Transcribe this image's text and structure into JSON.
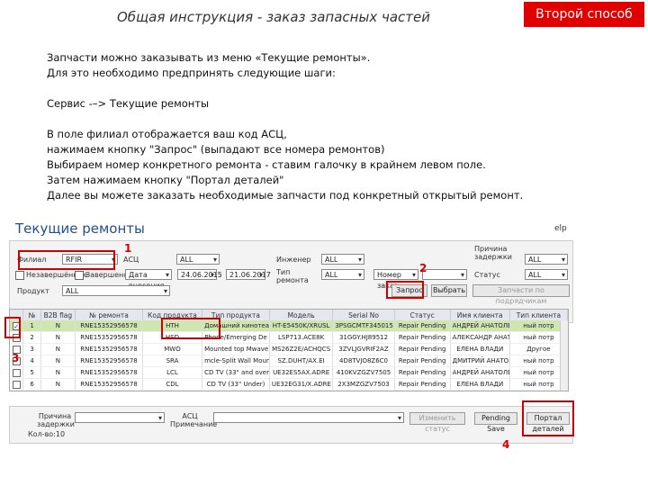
{
  "header": {
    "title": "Общая инструкция - заказ запасных частей",
    "badge": "Второй способ"
  },
  "instructions": [
    "Запчасти можно заказывать из меню «Текущие ремонты».",
    "Для это необходимо предпринять следующие шаги:",
    "Сервис -–> Текущие ремонты",
    "В поле филиал отображается ваш код АСЦ,",
    "нажимаем кнопку \"Запрос\" (выпадают все номера ремонтов)",
    "Выбираем номер конкретного ремонта - ставим галочку в крайнем левом поле.",
    "Затем нажимаем кнопку \"Портал деталей\"",
    "Далее вы можете заказать необходимые запчасти под конкретный открытый ремонт."
  ],
  "app": {
    "title": "Текущие ремонты",
    "help": "elp",
    "filters": {
      "branch_label": "Филиал",
      "branch_value": "RFIR",
      "asc_label": "АСЦ",
      "asc_value": "ALL",
      "engineer_label": "Инженер",
      "engineer_value": "ALL",
      "delay_reason_label": "Причина задержки",
      "delay_reason_value": "ALL",
      "unfinished_label": "Незавершённые",
      "finished_label": "Завершено",
      "date_select": "Дата внесения",
      "date_from": "24.06.2015",
      "date_to": "21.06.2017",
      "repair_type_label": "Тип ремонта",
      "repair_type_value": "ALL",
      "number_select": "Номер заказ",
      "search_value": "",
      "status_label": "Статус",
      "status_value": "ALL",
      "product_label": "Продукт",
      "product_value": "ALL",
      "query_button": "Запрос",
      "select_button": "Выбрать",
      "other_button": "Запчасти по подрядчикам"
    },
    "grid": {
      "columns": [
        "",
        "№",
        "B2B flag",
        "№ ремонта",
        "Код продукта",
        "Тип продукта",
        "Модель",
        "Serial No",
        "Статус",
        "Имя клиента",
        "Тип клиента"
      ],
      "rows": [
        [
          "",
          "1",
          "N",
          "RNE15352956578",
          "HTH",
          "Домашний кинотеатр",
          "HT-E5450K/XRUSL",
          "3PSGCMTF345015",
          "Repair Pending",
          "АНДРЕЙ АНАТОЛЕ",
          "ный потр"
        ],
        [
          "",
          "2",
          "N",
          "RNE15352956578",
          "HSD",
          "Phone/Emerging De",
          "LSP713.ACE8K",
          "31GGY.HJ89512",
          "Repair Pending",
          "АЛЕКСАНДР АНАТОЛЕ",
          "ный потр"
        ],
        [
          "",
          "3",
          "N",
          "RNE15352956578",
          "MWO",
          "Mounted top Mwave",
          "MS26Z2E/ACHQCS",
          "3ZVLJGVRIF2AZ",
          "Repair Pending",
          "ЕЛЕНА ВЛАДИ",
          "Другое"
        ],
        [
          "",
          "4",
          "N",
          "RNE15352956578",
          "SRA",
          "mcle-Split Wall Mounte",
          "SZ.DUHT/AX.EI",
          "4D8TVJO8Z6C0",
          "Repair Pending",
          "ДМИТРИЙ АНАТОЛ",
          "ный потр"
        ],
        [
          "",
          "5",
          "N",
          "RNE15352956578",
          "LCL",
          "CD TV (33\" and over",
          "UE32ES5AX.ADRE",
          "410KVZGZV7505",
          "Repair Pending",
          "АНДРЕЙ АНАТОЛЕ",
          "ный потр"
        ],
        [
          "",
          "6",
          "N",
          "RNE15352956578",
          "CDL",
          "CD TV (33\" Under)",
          "UE32EG31/X.ADRE",
          "2X3MZGZV7503",
          "Repair Pending",
          "ЕЛЕНА ВЛАДИ",
          "ный потр"
        ]
      ]
    },
    "bottom": {
      "reason_label": "Причина задержки",
      "asc_comment_label": "АСЦ Примечание",
      "change_status_button": "Изменить статус",
      "pending_save_button": "Pending Save",
      "parts_portal_button": "Портал деталей",
      "counter_label": "Кол-во:10"
    },
    "markers": [
      "1",
      "2",
      "3",
      "4"
    ]
  }
}
